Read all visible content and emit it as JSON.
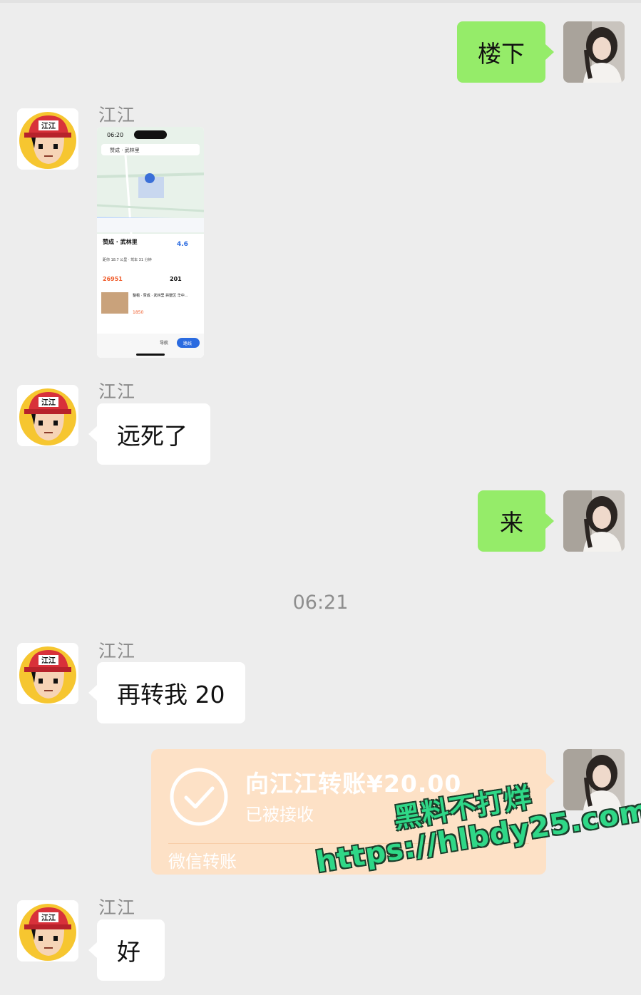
{
  "contact": {
    "name": "江江"
  },
  "messages": {
    "m1": {
      "text": "楼下"
    },
    "m2": {
      "sender": "江江"
    },
    "m3": {
      "sender": "江江",
      "text": "远死了"
    },
    "m4": {
      "text": "来"
    },
    "m5": {
      "sender": "江江",
      "text": "再转我 20"
    },
    "m7": {
      "sender": "江江",
      "text": "好"
    }
  },
  "timestamp": "06:21",
  "transfer": {
    "title": "向江江转账¥20.00",
    "status": "已被接收",
    "footer": "微信转账"
  },
  "map_screenshot": {
    "time": "06:20",
    "search": "赞成 · 武林里",
    "place_name": "赞成 · 武林里",
    "rating": "4.6",
    "distance_info": "距你 18.7 公里 · 驾车 31 分钟",
    "price": "26951",
    "count": "201",
    "listing": "整租 · 赞成 · 武林里 拱墅区 华中...",
    "listing_price": "1850",
    "nav_label": "导航",
    "go_label": "路线"
  },
  "watermark": {
    "line1": "黑料不打烊",
    "line2": "https://hlbdy25.com"
  },
  "colors": {
    "background": "#ededed",
    "self_bubble": "#95ec69",
    "other_bubble": "#ffffff",
    "transfer_card": "#fde1c6",
    "watermark": "#2fd787"
  },
  "icons": {
    "self_avatar": "girl-photo-avatar",
    "other_avatar": "cartoon-boy-cap-avatar",
    "transfer": "check-circle-icon"
  }
}
